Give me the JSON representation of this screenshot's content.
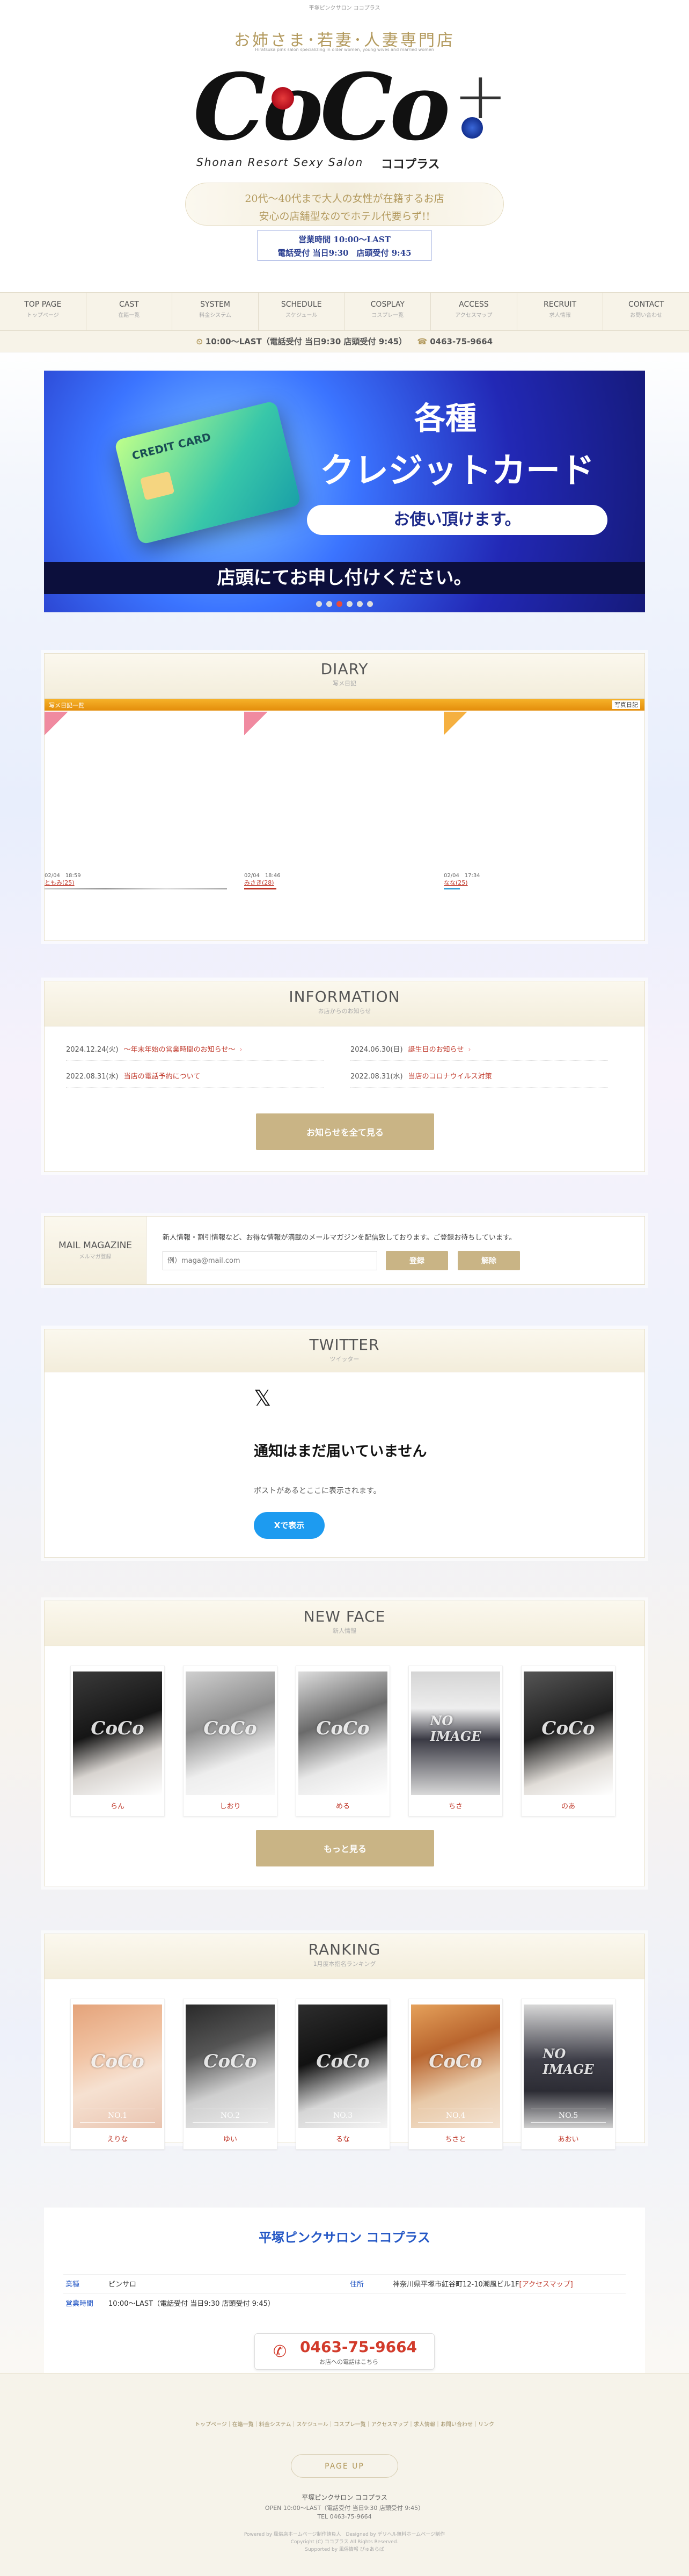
{
  "header": {
    "tagline_top": "平塚ピンクサロン ココプラス",
    "catch": "お姉さま･若妻･人妻専門店",
    "catch_sub": "Hiratsuka pink salon specializing in older women, young wives and married women",
    "logo_main": "CoCo",
    "logo_plus": "+",
    "logo_en": "Shonan Resort Sexy Salon",
    "logo_kana": "ココプラス",
    "desc1": "20代〜40代まで大人の女性が在籍するお店",
    "desc2": "安心の店舗型なのでホテル代要らず!!",
    "hours_label": "営業時間",
    "hours": "10:00〜LAST",
    "phone_line": "電話受付 当日9:30",
    "shop_line": "店頭受付 9:45"
  },
  "nav": [
    {
      "en": "TOP PAGE",
      "jp": "トップページ"
    },
    {
      "en": "CAST",
      "jp": "在籍一覧"
    },
    {
      "en": "SYSTEM",
      "jp": "料金システム"
    },
    {
      "en": "SCHEDULE",
      "jp": "スケジュール"
    },
    {
      "en": "COSPLAY",
      "jp": "コスプレ一覧"
    },
    {
      "en": "ACCESS",
      "jp": "アクセスマップ"
    },
    {
      "en": "RECRUIT",
      "jp": "求人情報"
    },
    {
      "en": "CONTACT",
      "jp": "お問い合わせ"
    }
  ],
  "infobar": {
    "hours": "10:00〜LAST（電話受付 当日9:30 店頭受付 9:45）",
    "phone": "0463-75-9664"
  },
  "banner": {
    "title": "各種",
    "title2": "クレジットカード",
    "pill": "お使い頂けます。",
    "bottom": "店頭にてお申し付けください。",
    "card_label": "CREDIT CARD"
  },
  "diary": {
    "en": "DIARY",
    "jp": "写メ日記",
    "bar": "写メ日記一覧",
    "bar_right": "写真日記",
    "entries": [
      {
        "date": "02/04　18:59",
        "name": "ともみ(25)"
      },
      {
        "date": "02/04　18:46",
        "name": "みさき(28)"
      },
      {
        "date": "02/04　17:34",
        "name": "なな(25)"
      }
    ]
  },
  "information": {
    "en": "INFORMATION",
    "jp": "お店からのお知らせ",
    "items": [
      {
        "date": "2024.12.24(火)",
        "title": "〜年末年始の営業時間のお知らせ〜"
      },
      {
        "date": "2024.06.30(日)",
        "title": "誕生日のお知らせ"
      },
      {
        "date": "2022.08.31(水)",
        "title": "当店の電話予約について"
      },
      {
        "date": "2022.08.31(水)",
        "title": "当店のコロナウイルス対策"
      }
    ],
    "button": "お知らせを全て見る"
  },
  "mail": {
    "en": "MAIL MAGAZINE",
    "jp": "メルマガ登録",
    "text": "新人情報・割引情報など、お得な情報が満載のメールマガジンを配信致しております。ご登録お待ちしています。",
    "placeholder": "例）maga@mail.com",
    "register": "登録",
    "cancel": "解除"
  },
  "twitter": {
    "en": "TWITTER",
    "jp": "ツイッター",
    "x": "𝕏",
    "title": "通知はまだ届いていません",
    "sub": "ポストがあるとここに表示されます。",
    "button": "Xで表示"
  },
  "newface": {
    "en": "NEW FACE",
    "jp": "新人情報",
    "cards": [
      {
        "name": "らん",
        "wm": "CoCo"
      },
      {
        "name": "しおり",
        "wm": "CoCo"
      },
      {
        "name": "める",
        "wm": "CoCo"
      },
      {
        "name": "ちさ",
        "wm": "NO IMAGE"
      },
      {
        "name": "のあ",
        "wm": "CoCo"
      }
    ],
    "button": "もっと見る"
  },
  "ranking": {
    "en": "RANKING",
    "jp": "1月度本指名ランキング",
    "cards": [
      {
        "rank": "NO.1",
        "name": "えりな",
        "wm": "CoCo"
      },
      {
        "rank": "NO.2",
        "name": "ゆい",
        "wm": "CoCo"
      },
      {
        "rank": "NO.3",
        "name": "るな",
        "wm": "CoCo"
      },
      {
        "rank": "NO.4",
        "name": "ちさと",
        "wm": "CoCo"
      },
      {
        "rank": "NO.5",
        "name": "あおい",
        "wm": "NO IMAGE"
      }
    ]
  },
  "shop": {
    "title": "平塚ピンクサロン ココプラス",
    "type_label": "業種",
    "type": "ピンサロ",
    "addr_label": "住所",
    "addr": "神奈川県平塚市紅谷町12-10潮風ビル1F",
    "map": "[アクセスマップ]",
    "hours_label": "営業時間",
    "hours": "10:00〜LAST（電話受付 当日9:30 店頭受付 9:45）",
    "phone": "0463-75-9664",
    "phone_sub": "お店への電話はこちら"
  },
  "footer": {
    "links": "トップページ｜在籍一覧｜料金システム｜スケジュール｜コスプレ一覧｜アクセスマップ｜求人情報｜お問い合わせ｜リンク",
    "pageup": "PAGE UP",
    "name": "平塚ピンクサロン ココプラス",
    "open": "OPEN 10:00〜LAST（電話受付 当日9:30 店頭受付 9:45）",
    "tel": "TEL 0463-75-9664",
    "powered": "Powered by 風俗店ホームページ制作請負人　Designed by デリヘル無料ホームページ制作",
    "copy": "Copyright (C) ココプラス All Rights Reserved.",
    "support": "Supported by 風俗情報 ぴゅあらば"
  }
}
